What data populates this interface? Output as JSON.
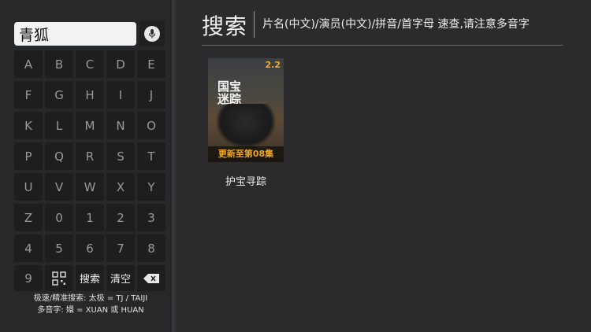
{
  "search": {
    "query": "青狐",
    "mic_icon": "mic-icon"
  },
  "keyboard": {
    "rows": [
      [
        "A",
        "B",
        "C",
        "D",
        "E"
      ],
      [
        "F",
        "G",
        "H",
        "I",
        "J"
      ],
      [
        "K",
        "L",
        "M",
        "N",
        "O"
      ],
      [
        "P",
        "Q",
        "R",
        "S",
        "T"
      ],
      [
        "U",
        "V",
        "W",
        "X",
        "Y"
      ],
      [
        "Z",
        "0",
        "1",
        "2",
        "3"
      ],
      [
        "4",
        "5",
        "6",
        "7",
        "8"
      ]
    ],
    "last_row": {
      "nine": "9",
      "qr_icon": "qr-code-icon",
      "search_label": "搜索",
      "clear_label": "清空",
      "backspace_icon": "backspace-icon"
    }
  },
  "hints": {
    "line1": "极速/精准搜索: 太极 = TJ / TAIJI",
    "line2": "多音字: 嬛 = XUAN 或 HUAN"
  },
  "header": {
    "title": "搜索",
    "tip": "片名(中文)/演员(中文)/拼音/首字母 速查,请注意多音字"
  },
  "results": [
    {
      "title": "护宝寻踪",
      "score": "2.2",
      "poster_text": "国宝\n迷踪",
      "update": "更新至第08集"
    }
  ],
  "colors": {
    "background": "#2b2b2d",
    "key_bg": "#1d1e20",
    "update_orange": "#f2a81c",
    "score_gold": "#f0b020"
  }
}
